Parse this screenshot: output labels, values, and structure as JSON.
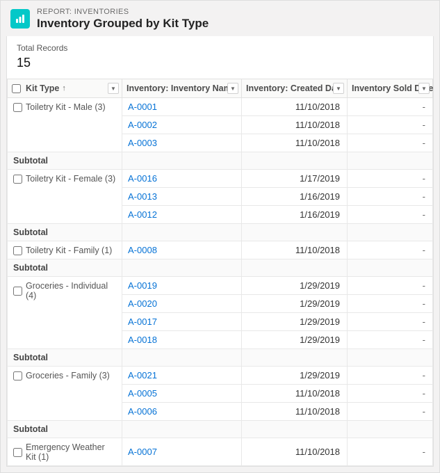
{
  "header": {
    "eyebrow": "REPORT: INVENTORIES",
    "title": "Inventory Grouped by Kit Type"
  },
  "totals": {
    "label": "Total Records",
    "value": "15"
  },
  "columns": {
    "kit": "Kit Type",
    "name": "Inventory: Inventory Name",
    "created": "Inventory: Created Date",
    "sold": "Inventory Sold Date"
  },
  "subtotal_label": "Subtotal",
  "sold_placeholder": "-",
  "groups": [
    {
      "label": "Toiletry Kit - Male (3)",
      "rows": [
        {
          "name": "A-0001",
          "created": "11/10/2018"
        },
        {
          "name": "A-0002",
          "created": "11/10/2018"
        },
        {
          "name": "A-0003",
          "created": "11/10/2018"
        }
      ]
    },
    {
      "label": "Toiletry Kit - Female (3)",
      "rows": [
        {
          "name": "A-0016",
          "created": "1/17/2019"
        },
        {
          "name": "A-0013",
          "created": "1/16/2019"
        },
        {
          "name": "A-0012",
          "created": "1/16/2019"
        }
      ]
    },
    {
      "label": "Toiletry Kit - Family (1)",
      "rows": [
        {
          "name": "A-0008",
          "created": "11/10/2018"
        }
      ]
    },
    {
      "label": "Groceries - Individual (4)",
      "rows": [
        {
          "name": "A-0019",
          "created": "1/29/2019"
        },
        {
          "name": "A-0020",
          "created": "1/29/2019"
        },
        {
          "name": "A-0017",
          "created": "1/29/2019"
        },
        {
          "name": "A-0018",
          "created": "1/29/2019"
        }
      ]
    },
    {
      "label": "Groceries - Family (3)",
      "rows": [
        {
          "name": "A-0021",
          "created": "1/29/2019"
        },
        {
          "name": "A-0005",
          "created": "11/10/2018"
        },
        {
          "name": "A-0006",
          "created": "11/10/2018"
        }
      ]
    },
    {
      "label": "Emergency Weather Kit (1)",
      "rows": [
        {
          "name": "A-0007",
          "created": "11/10/2018"
        }
      ]
    }
  ]
}
